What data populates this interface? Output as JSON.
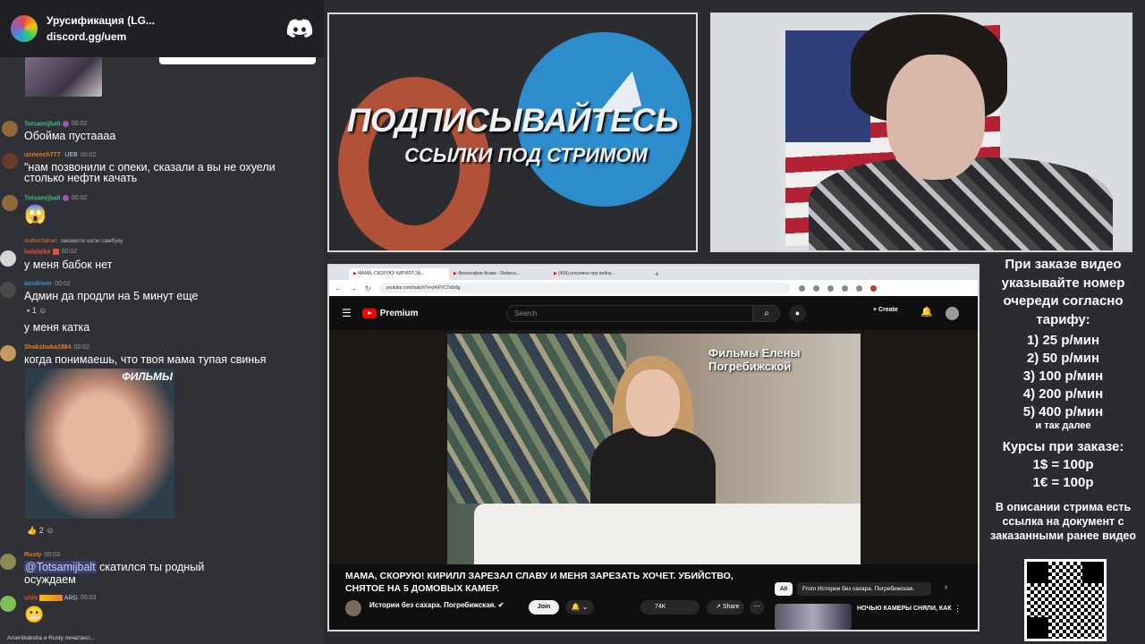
{
  "discord": {
    "server_name": "Урусификация (LG...",
    "server_link": "discord.gg/uem"
  },
  "chat": [
    {
      "user": "Totsamijbalt",
      "user_color": "#43b581",
      "time": "00:02",
      "text": "Обойма пустаааа"
    },
    {
      "user": "unneech777",
      "user_color": "#e67e22",
      "badge": "UEB",
      "time": "00:02",
      "text_line1": "\"нам позвонили с опеки, сказали а вы не охуели",
      "text_line2": "столько нефти качать"
    },
    {
      "user": "Totsamijbalt",
      "user_color": "#43b581",
      "time": "00:02",
      "emoji": "😱"
    },
    {
      "reply_user": "Authoritarian",
      "reply_text": "закажите катю самбуку"
    },
    {
      "user": "balalaika",
      "user_color": "#e74c3c",
      "time": "00:02",
      "text": "у меня бабок нет"
    },
    {
      "user": "assdriver",
      "user_color": "#3498db",
      "time": "00:02",
      "text": "Админ да продли на 5 минут еще",
      "reaction_count": "1"
    },
    {
      "text": "у меня катка"
    },
    {
      "user": "Shakshuka1984",
      "user_color": "#e67e22",
      "time": "00:02",
      "text": "когда понимаешь, что твоя мама тупая свинья",
      "image_label": "ФИЛЬМЫ",
      "reaction_count": "2"
    },
    {
      "user": "Rusty",
      "user_color": "#e67e22",
      "time": "00:03",
      "mention": "@Totsamijbalt",
      "text_after": " скатился ты родный",
      "text_line2": "осуждаем"
    },
    {
      "user": "shtir",
      "user_color": "#e74c3c",
      "badge": "ARG",
      "time": "00:03",
      "emoji": "😬"
    }
  ],
  "typing": "Arsenikaksha и Rusty печатают...",
  "banner": {
    "title": "ПОДПИСЫВАЙТЕСЬ",
    "subtitle": "ССЫЛКИ ПОД СТРИМОМ"
  },
  "browser": {
    "tabs": [
      "МАМА, СКОРУЮ! КИРИЛЛ ЗА...",
      "Философия Агаме - Rebeca...",
      "(409) россияне про войну..."
    ],
    "url": "youtube.com/watch?v=zKKVC7x6r8g"
  },
  "youtube": {
    "brand": "Premium",
    "search_placeholder": "Search",
    "create_label": "Create",
    "video_watermark": "Фильмы Елены Погребижской",
    "video_title": "МАМА, СКОРУЮ! КИРИЛЛ ЗАРЕЗАЛ СЛАВУ И МЕНЯ ЗАРЕЗАТЬ ХОЧЕТ. УБИЙСТВО, СНЯТОЕ НА 5 ДОМОВЫХ КАМЕР.",
    "channel_name": "Истории без сахара. Погребижская.",
    "join_label": "Join",
    "likes": "74K",
    "share_label": "Share",
    "chip_all": "All",
    "chip_from": "From Истории без сахара. Погребижская.",
    "rec_title": "НОЧЬЮ КАМЕРЫ СНЯЛИ, КАК"
  },
  "info": {
    "header": "При заказе видео указывайте номер очереди согласно тарифу:",
    "tariffs": [
      "1) 25 р/мин",
      "2) 50 р/мин",
      "3) 100 р/мин",
      "4) 200 р/мин",
      "5) 400 р/мин"
    ],
    "etc": "и так далее",
    "courses_title": "Курсы при заказе:",
    "course_usd": "1$ = 100р",
    "course_eur": "1€ = 100р",
    "description": "В описании стрима есть ссылка на документ с заказанными ранее видео"
  },
  "colors": {
    "discord_bg": "#2f3136",
    "accent_red": "#ff0000",
    "telegram_blue": "#2d8ccc"
  }
}
